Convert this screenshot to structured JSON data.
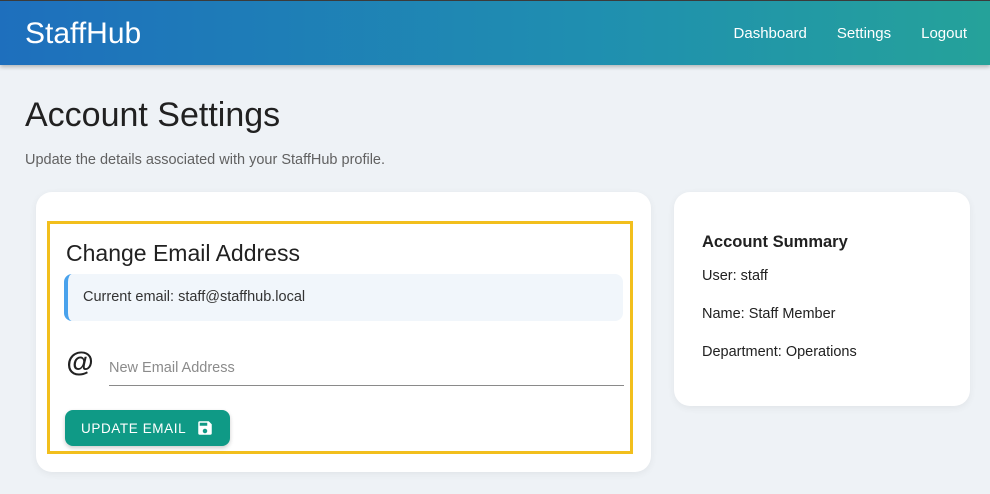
{
  "navbar": {
    "brand": "StaffHub",
    "links": [
      "Dashboard",
      "Settings",
      "Logout"
    ]
  },
  "page": {
    "title": "Account Settings",
    "subtitle": "Update the details associated with your StaffHub profile."
  },
  "change_email": {
    "title": "Change Email Address",
    "current_email": "Current email: staff@staffhub.local",
    "input_placeholder": "New Email Address",
    "input_value": "",
    "button_label": "UPDATE EMAIL",
    "icons": {
      "field": "at-icon",
      "button": "save-icon"
    }
  },
  "summary": {
    "title": "Account Summary",
    "user": "User: staff",
    "name": "Name: Staff Member",
    "department": "Department: Operations"
  },
  "colors": {
    "nav_start": "#1e6fbd",
    "nav_end": "#25a29a",
    "accent": "#0f9a86",
    "highlight": "#f2bf1d",
    "info_border": "#49a2ec"
  }
}
